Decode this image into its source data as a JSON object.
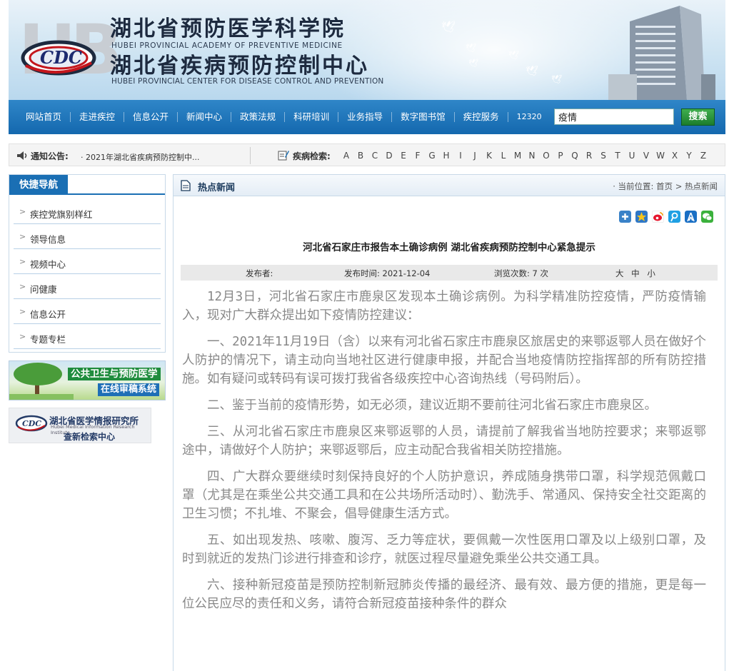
{
  "header": {
    "org1_cn": "湖北省预防医学科学院",
    "org1_en": "HUBEI PROVINCIAL ACADEMY OF PREVENTIVE MEDICINE",
    "org2_cn": "湖北省疾病预防控制中心",
    "org2_en": "HUBEI PROVINCIAL CENTER FOR DISEASE CONTROL AND PREVENTION",
    "logo_icon": "cdc-logo-icon",
    "brand_color": "#1a6fb4"
  },
  "nav": {
    "items": [
      "网站首页",
      "走进疾控",
      "信息公开",
      "新闻中心",
      "政策法规",
      "科研培训",
      "业务指导",
      "数字图书馆",
      "疾控服务",
      "12320"
    ],
    "search_value": "疫情",
    "search_button": "搜索"
  },
  "notice": {
    "label": "通知公告:",
    "text": "· 2021年湖北省疾病预防控制中...",
    "disease_label": "疾病检索:",
    "letters": [
      "A",
      "B",
      "C",
      "D",
      "E",
      "F",
      "G",
      "H",
      "I",
      "J",
      "K",
      "L",
      "M",
      "N",
      "O",
      "P",
      "Q",
      "R",
      "S",
      "T",
      "U",
      "V",
      "W",
      "X",
      "Y",
      "Z"
    ]
  },
  "sidebar": {
    "title": "快捷导航",
    "items": [
      "疾控党旗别样红",
      "领导信息",
      "视频中心",
      "问健康",
      "信息公开",
      "专题专栏"
    ],
    "ad1_line1": "公共卫生与预防医学",
    "ad1_line2": "在线审稿系统",
    "ad2_title": "湖北省医学情报研究所",
    "ad2_en": "Hubei Medical Information Research Institute",
    "ad2_sub": "查新检索中心"
  },
  "main": {
    "section_title": "热点新闻",
    "breadcrumb_prefix": "· 当前位置:",
    "breadcrumb_home": "首页",
    "breadcrumb_sep": ">",
    "breadcrumb_current": "热点新闻",
    "share_icons": [
      "plus-share-icon",
      "qzone-icon",
      "weibo-icon",
      "tencent-weibo-icon",
      "renren-icon",
      "wechat-icon"
    ],
    "article_title": "河北省石家庄市报告本土确诊病例 湖北省疾病预防控制中心紧急提示",
    "meta_publisher": "发布者:",
    "meta_time": "发布时间: 2021-12-04",
    "meta_views": "浏览次数: 7 次",
    "font_sizes": [
      "大",
      "中",
      "小"
    ],
    "paragraphs": [
      "12月3日，河北省石家庄市鹿泉区发现本土确诊病例。为科学精准防控疫情，严防疫情输入，现对广大群众提出如下疫情防控建议：",
      "一、2021年11月19日（含）以来有河北省石家庄市鹿泉区旅居史的来鄂返鄂人员在做好个人防护的情况下，请主动向当地社区进行健康申报，并配合当地疫情防控指挥部的所有防控措施。如有疑问或转码有误可拨打我省各级疾控中心咨询热线（号码附后）。",
      "二、鉴于当前的疫情形势，如无必须，建议近期不要前往河北省石家庄市鹿泉区。",
      "三、从河北省石家庄市鹿泉区来鄂返鄂的人员，请提前了解我省当地防控要求；来鄂返鄂途中，请做好个人防护；来鄂返鄂后，应主动配合我省相关防控措施。",
      "四、广大群众要继续时刻保持良好的个人防护意识，养成随身携带口罩，科学规范佩戴口罩（尤其是在乘坐公共交通工具和在公共场所活动时）、勤洗手、常通风、保持安全社交距离的卫生习惯；不扎堆、不聚会，倡导健康生活方式。",
      "五、如出现发热、咳嗽、腹泻、乏力等症状，要佩戴一次性医用口罩及以上级别口罩，及时到就近的发热门诊进行排查和诊疗，就医过程尽量避免乘坐公共交通工具。",
      "六、接种新冠疫苗是预防控制新冠肺炎传播的最经济、最有效、最方便的措施，更是每一位公民应尽的责任和义务，请符合新冠疫苗接种条件的群众"
    ]
  }
}
